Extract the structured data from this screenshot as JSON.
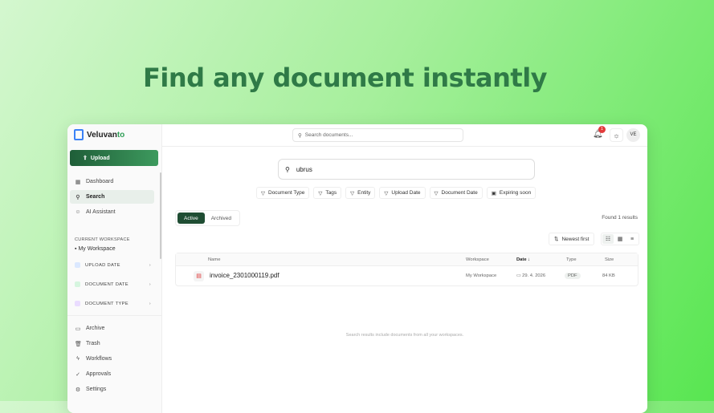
{
  "headline": "Find any document instantly",
  "app": {
    "brand_a": "Veluvan",
    "brand_b": "to"
  },
  "sidebar": {
    "upload": "Upload",
    "nav": [
      {
        "label": "Dashboard",
        "icon": "grid-icon"
      },
      {
        "label": "Search",
        "icon": "search-icon",
        "active": true
      },
      {
        "label": "AI Assistant",
        "icon": "robot-icon"
      }
    ],
    "workspace_heading": "CURRENT WORKSPACE",
    "workspace": "My Workspace",
    "groups": [
      {
        "label": "UPLOAD DATE",
        "color": "#dbe8ff"
      },
      {
        "label": "DOCUMENT DATE",
        "color": "#d6f5df"
      },
      {
        "label": "DOCUMENT TYPE",
        "color": "#eadcff"
      }
    ],
    "bottom": [
      {
        "label": "Archive"
      },
      {
        "label": "Trash"
      },
      {
        "label": "Workflows"
      },
      {
        "label": "Approvals"
      },
      {
        "label": "Settings"
      }
    ]
  },
  "header": {
    "search_placeholder": "Search documents...",
    "notifications": "1",
    "avatar": "VE"
  },
  "search": {
    "query": "ubrus"
  },
  "filters": [
    "Document Type",
    "Tags",
    "Entity",
    "Upload Date",
    "Document Date",
    "Expiring soon"
  ],
  "tabs": [
    "Active",
    "Archived"
  ],
  "found": "Found 1 results",
  "sort": "Newest first",
  "table": {
    "headers": [
      "Name",
      "Workspace",
      "Date ↓",
      "Type",
      "Size"
    ],
    "rows": [
      {
        "name": "invoice_2301000119.pdf",
        "workspace": "My Workspace",
        "date": "29. 4. 2026",
        "type": "PDF",
        "size": "84 KB"
      }
    ]
  },
  "note": "Search results include documents from all your workspaces."
}
